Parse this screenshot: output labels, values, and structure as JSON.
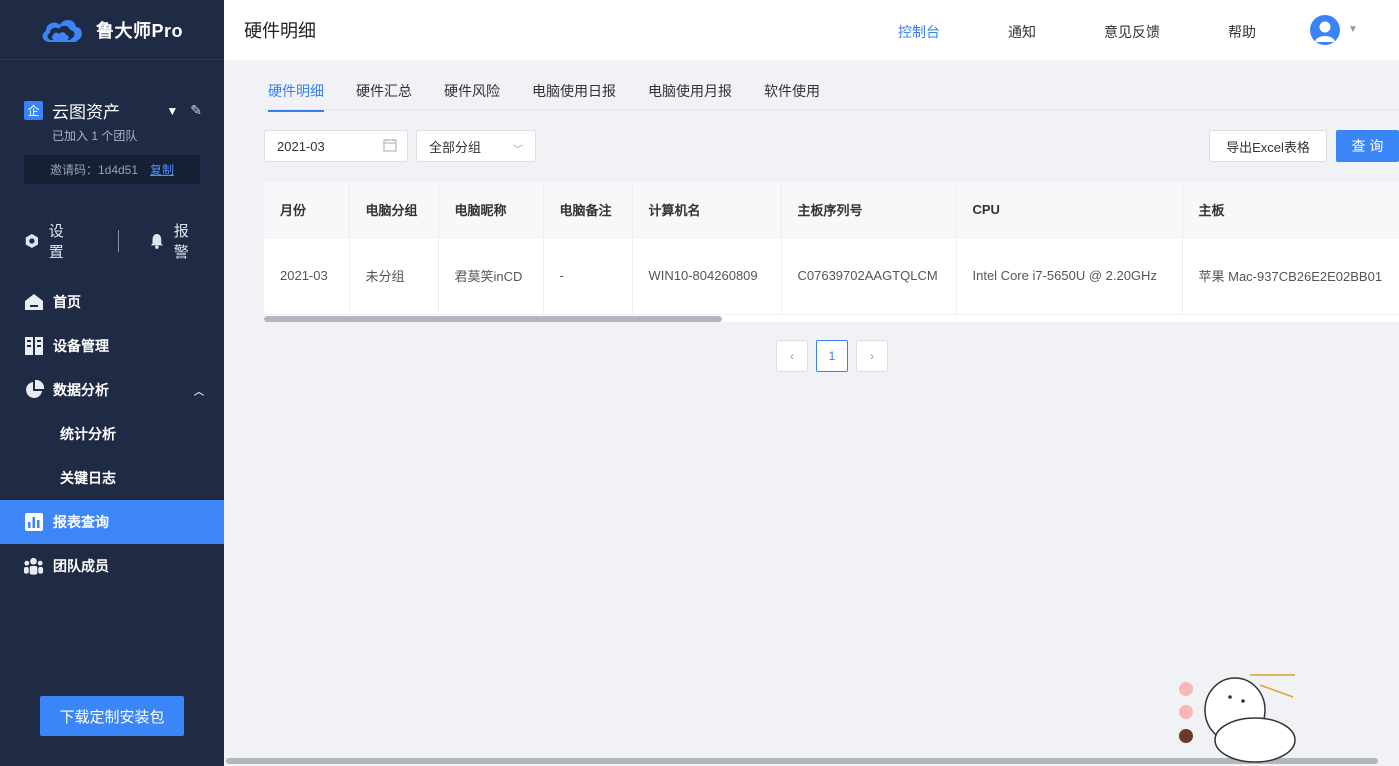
{
  "app": {
    "name": "鲁大师Pro"
  },
  "team": {
    "badge": "企",
    "name": "云图资产",
    "sub": "已加入 1 个团队",
    "invite_label": "邀请码：1d4d51",
    "copy_label": "复制"
  },
  "quick": {
    "settings": "设置",
    "alarm": "报警"
  },
  "nav": {
    "home": "首页",
    "devices": "设备管理",
    "analysis": "数据分析",
    "stats": "统计分析",
    "keylog": "关键日志",
    "reports": "报表查询",
    "members": "团队成员"
  },
  "download_label": "下载定制安装包",
  "header": {
    "title": "硬件明细",
    "console": "控制台",
    "notify": "通知",
    "feedback": "意见反馈",
    "help": "帮助"
  },
  "tabs": [
    "硬件明细",
    "硬件汇总",
    "硬件风险",
    "电脑使用日报",
    "电脑使用月报",
    "软件使用"
  ],
  "filters": {
    "month": "2021-03",
    "group": "全部分组",
    "export_label": "导出Excel表格",
    "query_label": "查 询"
  },
  "table": {
    "headers": [
      "月份",
      "电脑分组",
      "电脑昵称",
      "电脑备注",
      "计算机名",
      "主板序列号",
      "CPU",
      "主板"
    ],
    "rows": [
      [
        "2021-03",
        "未分组",
        "君莫笑inCD",
        "-",
        "WIN10-804260809",
        "C07639702AAGTQLCM",
        "Intel Core i7-5650U @ 2.20GHz",
        "苹果 Mac-937CB26E2E02BB01"
      ]
    ]
  },
  "pagination": {
    "current": "1"
  },
  "colors": {
    "sidebar": "#1f2a44",
    "accent": "#3a86f6"
  }
}
